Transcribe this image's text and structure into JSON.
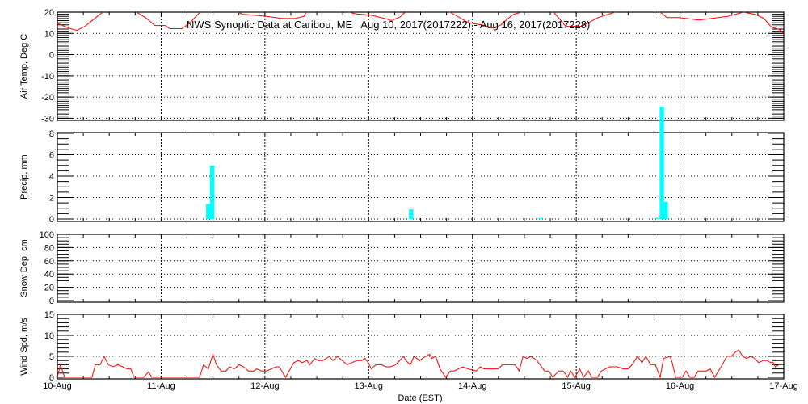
{
  "chart_data": {
    "type": "line",
    "title": "NWS Synoptic Data at Caribou, ME   Aug 10, 2017(2017222) - Aug 16, 2017(2017228)",
    "xlabel": "Date (EST)",
    "x_units": "hours since 10-Aug 00:00 EST",
    "xlim": [
      0,
      168
    ],
    "x_ticks": [
      {
        "value": 0,
        "label": "10-Aug"
      },
      {
        "value": 24,
        "label": "11-Aug"
      },
      {
        "value": 48,
        "label": "12-Aug"
      },
      {
        "value": 72,
        "label": "13-Aug"
      },
      {
        "value": 96,
        "label": "14-Aug"
      },
      {
        "value": 120,
        "label": "15-Aug"
      },
      {
        "value": 144,
        "label": "16-Aug"
      },
      {
        "value": 168,
        "label": "17-Aug"
      }
    ],
    "grid": true,
    "panels": [
      {
        "id": "air-temp",
        "type": "line",
        "ylabel": "Air Temp, Deg C",
        "ylim": [
          -31,
          20
        ],
        "yticks": [
          20,
          10,
          0,
          -10,
          -20,
          -30
        ],
        "minor_step": 1,
        "color": "#ff0000",
        "series": [
          {
            "name": "Air Temp",
            "x": [
              0,
              2.6,
              4.5,
              6.4,
              8.2,
              10.5,
              15,
              20.4,
              22.6,
              25,
              26,
              28.8,
              30.7,
              33,
              38,
              42.8,
              45.6,
              48.4,
              52,
              55,
              57,
              57.6,
              62,
              67.5,
              69,
              72.7,
              76.4,
              77.3,
              79.3,
              80.2,
              86,
              90.8,
              95,
              98.9,
              100.7,
              102.6,
              104.5,
              105.4,
              107.3,
              110,
              114.8,
              117.6,
              121.3,
              125,
              129,
              134,
              139.4,
              141,
              143.7,
              148.4,
              151.2,
              155,
              158.7,
              161.5,
              163.4,
              165.2,
              167,
              168
            ],
            "y": [
              14.8,
              12.5,
              11.4,
              13.3,
              16.3,
              20,
              24,
              17.4,
              13.7,
              13.7,
              12.2,
              12.2,
              15,
              20,
              24.5,
              19,
              18.5,
              18,
              17,
              17,
              18,
              20,
              24,
              20,
              19.2,
              18.5,
              16.6,
              16,
              17.8,
              19.6,
              25,
              20,
              15.1,
              13.7,
              12.5,
              14,
              17.4,
              18.9,
              20,
              25,
              20,
              13.3,
              13.3,
              17.4,
              20,
              24,
              20,
              17.4,
              17.4,
              16.3,
              17,
              18,
              20,
              18.9,
              17,
              12.9,
              11.8,
              10
            ]
          }
        ]
      },
      {
        "id": "precip",
        "type": "bar",
        "ylabel": "Precip, mm",
        "ylim": [
          0,
          8
        ],
        "yticks": [
          8,
          6,
          4,
          2,
          0
        ],
        "minor_step": 0.5,
        "color": "#00ffff",
        "bar_width_hours": 1,
        "bars": {
          "x": [
            34.9,
            35.8,
            81.8,
            111.8,
            138.9,
            139.8,
            140.7
          ],
          "y": [
            1.4,
            5.0,
            0.9,
            0.1,
            0.1,
            10.5,
            1.6
          ]
        }
      },
      {
        "id": "snow-depth",
        "type": "line",
        "ylabel": "Snow Dep, cm",
        "ylim": [
          0,
          100
        ],
        "yticks": [
          100,
          80,
          60,
          40,
          20,
          0
        ],
        "minor_step": 5,
        "color": "#ff0000",
        "series": []
      },
      {
        "id": "wind-speed",
        "type": "line",
        "ylabel": "Wind Spd, m/s",
        "ylim": [
          0,
          15
        ],
        "yticks": [
          15,
          10,
          5,
          0
        ],
        "minor_step": 1,
        "color": "#ff0000",
        "series": [
          {
            "name": "Wind Speed",
            "x": [
              0,
              0.7,
              1.7,
              8,
              8.8,
              9.9,
              10.8,
              11.8,
              12.9,
              14,
              15.1,
              16.2,
              17,
              17.7,
              20,
              21.1,
              21.8,
              32.9,
              33.8,
              34.9,
              36,
              36.8,
              37.9,
              39,
              39.8,
              40.9,
              42,
              43.1,
              44.2,
              45.4,
              46.1,
              47.2,
              48.4,
              49.5,
              50.6,
              51.3,
              52.8,
              53.6,
              54.7,
              55.8,
              56.6,
              57.7,
              58.4,
              59.5,
              60.3,
              61.4,
              62.9,
              63.7,
              64.8,
              65.9,
              67,
              68.1,
              69.3,
              70.4,
              71.1,
              71.9,
              72.6,
              73.7,
              74.9,
              76,
              77.1,
              78.2,
              80.1,
              80.6,
              81.6,
              82.5,
              83.8,
              85.1,
              86.1,
              86.6,
              87.5,
              88.5,
              89.8,
              90.9,
              91.8,
              93.7,
              95,
              96.9,
              97.8,
              98.7,
              101.9,
              103,
              105.8,
              106.8,
              107.7,
              108.6,
              109.6,
              110.9,
              112.7,
              113.7,
              114.6,
              115.9,
              117,
              118,
              118.7,
              119.7,
              120.8,
              121.7,
              122.8,
              123.6,
              124.9,
              125.8,
              127.7,
              129.5,
              130.9,
              132,
              132.9,
              134.2,
              135.2,
              136.1,
              137.2,
              138.3,
              139.4,
              140.2,
              141.7,
              142.2,
              143,
              144.5,
              145.4,
              146.3,
              147.3,
              148.2,
              150.1,
              151,
              152,
              152.9,
              153.8,
              154.8,
              155.9,
              156.8,
              157.6,
              158.5,
              159.4,
              160.4,
              161.3,
              162.2,
              163.2,
              164.1,
              165,
              165.6,
              166,
              166.9,
              167.8
            ],
            "y": [
              0,
              3,
              0,
              0,
              3,
              3,
              5,
              3,
              2.5,
              3,
              2.5,
              2,
              2,
              0,
              0,
              1.3,
              0,
              0,
              3,
              2,
              5.5,
              3,
              1.5,
              1.5,
              2.5,
              2,
              3,
              2.5,
              1.5,
              1.5,
              2,
              1.5,
              1.5,
              2,
              2.5,
              2.5,
              0,
              1.5,
              3.5,
              4,
              3.5,
              4,
              3,
              4.5,
              4,
              4,
              5,
              4,
              5,
              4,
              3,
              3.5,
              4,
              4,
              4.5,
              3.5,
              2,
              3,
              3,
              2.5,
              2.5,
              3,
              5,
              4,
              3,
              5,
              4,
              5,
              5.5,
              4.5,
              5,
              2,
              0,
              1.5,
              1.5,
              2.5,
              2,
              1.5,
              2.5,
              2,
              2,
              3,
              3,
              1.5,
              5,
              4.5,
              5,
              4,
              1.5,
              1.5,
              0,
              1.5,
              1.5,
              0,
              1.5,
              0,
              2,
              0,
              1.5,
              0,
              0,
              1.5,
              2.5,
              2.5,
              2,
              2,
              3,
              5,
              3.5,
              5,
              3,
              3,
              0,
              4.5,
              5,
              3.5,
              0,
              0,
              1.5,
              0,
              0,
              1.5,
              1.5,
              2,
              0,
              1.5,
              3,
              5,
              5,
              6,
              6.5,
              5,
              4.5,
              5,
              4.5,
              3.5,
              4,
              4,
              3.5,
              3.5,
              2.5,
              3,
              3
            ]
          }
        ]
      }
    ]
  }
}
